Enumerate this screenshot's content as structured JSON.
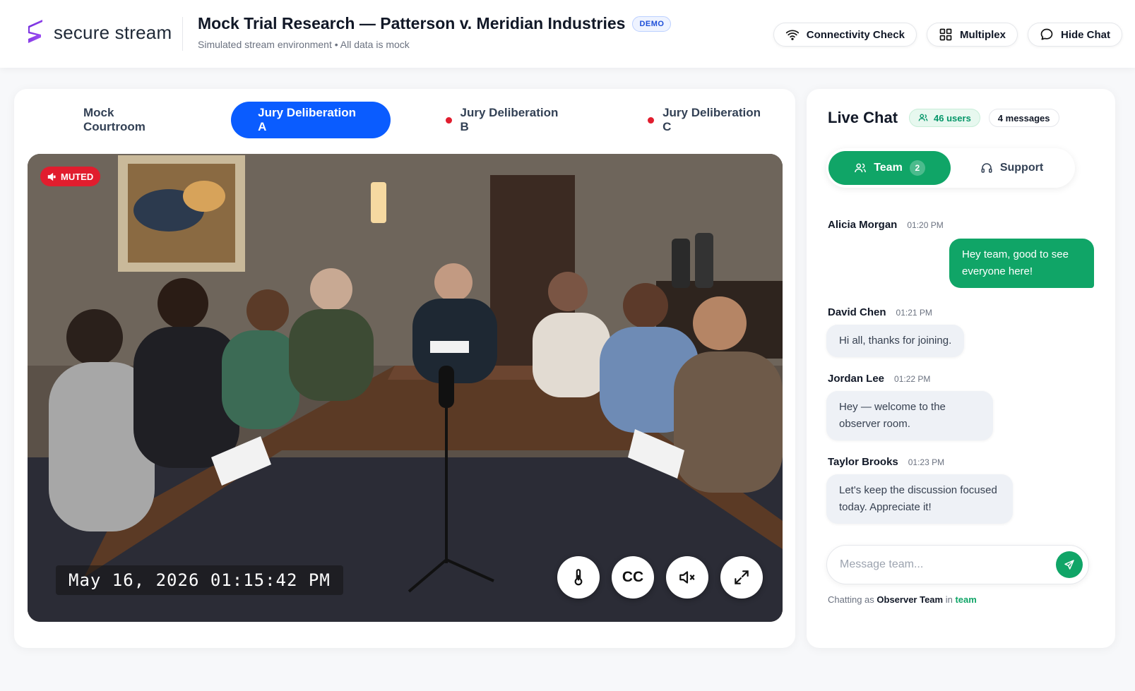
{
  "brand": {
    "name": "secure stream"
  },
  "header": {
    "title": "Mock Trial Research — Patterson v. Meridian Industries",
    "badge": "DEMO",
    "subtitle": "Simulated stream environment • All data is mock",
    "actions": [
      {
        "label": "Connectivity Check",
        "icon": "wifi-icon"
      },
      {
        "label": "Multiplex",
        "icon": "grid-icon"
      },
      {
        "label": "Hide Chat",
        "icon": "chat-bubble-icon"
      }
    ]
  },
  "tabs": [
    {
      "label": "Mock Courtroom",
      "active": false,
      "live": false
    },
    {
      "label": "Jury Deliberation A",
      "active": true,
      "live": false
    },
    {
      "label": "Jury Deliberation B",
      "active": false,
      "live": true
    },
    {
      "label": "Jury Deliberation C",
      "active": false,
      "live": true
    }
  ],
  "video": {
    "muted_label": "MUTED",
    "timestamp": "May 16, 2026 01:15:42 PM",
    "controls": [
      {
        "name": "temperature-button",
        "icon": "thermometer-icon"
      },
      {
        "name": "captions-button",
        "label": "CC"
      },
      {
        "name": "mute-toggle-button",
        "icon": "speaker-muted-icon"
      },
      {
        "name": "fullscreen-button",
        "icon": "expand-icon"
      }
    ]
  },
  "chat": {
    "title": "Live Chat",
    "users_count": "46 users",
    "messages_count": "4 messages",
    "channels": [
      {
        "label": "Team",
        "count": "2",
        "active": true,
        "icon": "users-icon"
      },
      {
        "label": "Support",
        "active": false,
        "icon": "headset-icon"
      }
    ],
    "messages": [
      {
        "author": "Alicia Morgan",
        "time": "01:20 PM",
        "text": "Hey team, good to see everyone here!",
        "outgoing": true
      },
      {
        "author": "David Chen",
        "time": "01:21 PM",
        "text": "Hi all, thanks for joining.",
        "outgoing": false
      },
      {
        "author": "Jordan Lee",
        "time": "01:22 PM",
        "text": "Hey — welcome to the observer room.",
        "outgoing": false
      },
      {
        "author": "Taylor Brooks",
        "time": "01:23 PM",
        "text": "Let's keep the discussion focused today. Appreciate it!",
        "outgoing": false
      }
    ],
    "composer": {
      "placeholder": "Message team..."
    },
    "footer": {
      "prefix": "Chatting as",
      "user": "Observer Team",
      "joiner": "in",
      "room": "team"
    }
  },
  "colors": {
    "primary_blue": "#0a5cff",
    "chat_green": "#10a567",
    "live_red": "#e11d2e"
  }
}
